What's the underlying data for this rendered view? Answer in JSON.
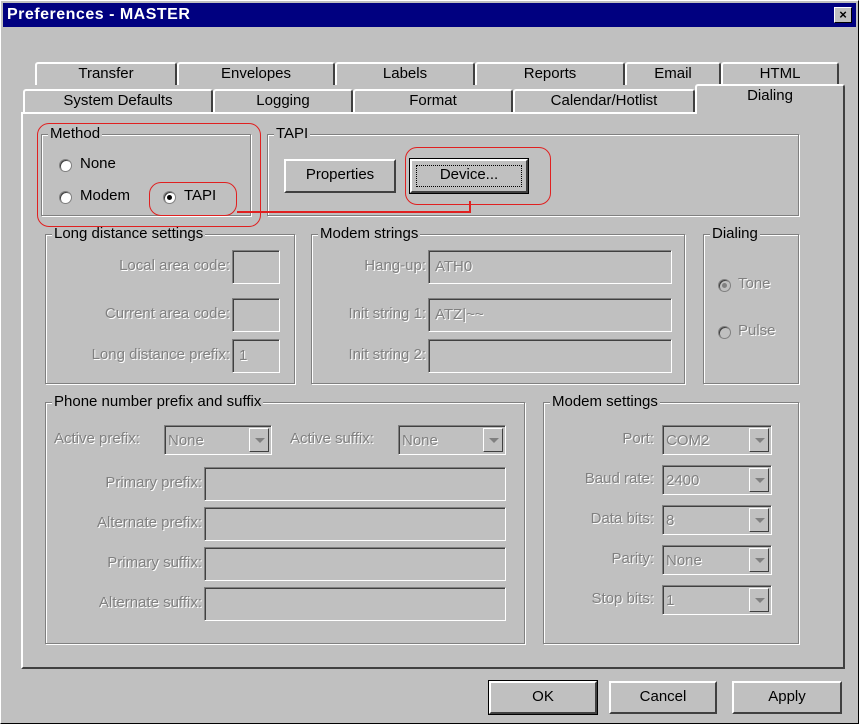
{
  "window": {
    "title": "Preferences  -  MASTER",
    "close_label": "×"
  },
  "tabs": {
    "row1": [
      "Transfer",
      "Envelopes",
      "Labels",
      "Reports",
      "Email",
      "HTML"
    ],
    "row2": [
      "System Defaults",
      "Logging",
      "Format",
      "Calendar/Hotlist",
      "Dialing"
    ],
    "active": "Dialing"
  },
  "method": {
    "legend": "Method",
    "options": [
      "None",
      "Modem",
      "TAPI"
    ],
    "selected": "TAPI"
  },
  "tapi": {
    "legend": "TAPI",
    "properties_label": "Properties",
    "device_label": "Device..."
  },
  "long_distance": {
    "legend": "Long distance settings",
    "local_area_code_label": "Local area code:",
    "local_area_code_value": "",
    "current_area_code_label": "Current area code:",
    "current_area_code_value": "",
    "prefix_label": "Long distance prefix:",
    "prefix_value": "1"
  },
  "modem_strings": {
    "legend": "Modem strings",
    "hangup_label": "Hang-up:",
    "hangup_value": "ATH0",
    "init1_label": "Init string 1:",
    "init1_value": "ATZ|~~",
    "init2_label": "Init string 2:",
    "init2_value": ""
  },
  "dialing": {
    "legend": "Dialing",
    "tone_label": "Tone",
    "pulse_label": "Pulse",
    "selected": "Tone"
  },
  "prefix_suffix": {
    "legend": "Phone number prefix and suffix",
    "active_prefix_label": "Active prefix:",
    "active_prefix_value": "None",
    "active_suffix_label": "Active suffix:",
    "active_suffix_value": "None",
    "primary_prefix_label": "Primary prefix:",
    "alternate_prefix_label": "Alternate prefix:",
    "primary_suffix_label": "Primary suffix:",
    "alternate_suffix_label": "Alternate suffix:"
  },
  "modem_settings": {
    "legend": "Modem settings",
    "port_label": "Port:",
    "port_value": "COM2",
    "baud_label": "Baud rate:",
    "baud_value": "2400",
    "databits_label": "Data bits:",
    "databits_value": "8",
    "parity_label": "Parity:",
    "parity_value": "None",
    "stopbits_label": "Stop bits:",
    "stopbits_value": "1"
  },
  "buttons": {
    "ok": "OK",
    "cancel": "Cancel",
    "apply": "Apply"
  },
  "annotation_color": "#e02020"
}
